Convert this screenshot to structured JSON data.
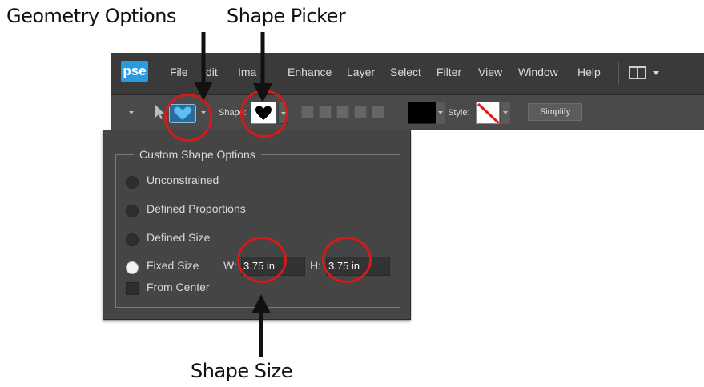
{
  "callouts": {
    "geometry_options": "Geometry Options",
    "shape_picker": "Shape Picker",
    "shape_size": "Shape Size"
  },
  "app": {
    "logo": "pse",
    "menu": [
      "File",
      "Edit",
      "Image",
      "Enhance",
      "Layer",
      "Select",
      "Filter",
      "View",
      "Window",
      "Help"
    ],
    "menu_visible": [
      "File",
      "dit",
      "Ima",
      "Enhance",
      "Layer",
      "Select",
      "Filter",
      "View",
      "Window",
      "Help"
    ]
  },
  "options_bar": {
    "shape_label": "Shape:",
    "style_label": "Style:",
    "simplify_label": "Simplify",
    "color": "#000000",
    "tool_icon": "custom-shape-heart-icon"
  },
  "popup": {
    "title": "Custom Shape Options",
    "options": [
      {
        "label": "Unconstrained",
        "selected": false
      },
      {
        "label": "Defined Proportions",
        "selected": false
      },
      {
        "label": "Defined Size",
        "selected": false
      },
      {
        "label": "Fixed Size",
        "selected": true
      }
    ],
    "width_label": "W:",
    "width_value": "3.75 in",
    "height_label": "H:",
    "height_value": "3.75 in",
    "from_center_label": "From Center",
    "from_center_checked": false
  },
  "colors": {
    "annotation_ring": "#d41a1a",
    "logo_blue": "#2a9be0",
    "menubar": "#3a3a3a",
    "panel": "#454545"
  }
}
